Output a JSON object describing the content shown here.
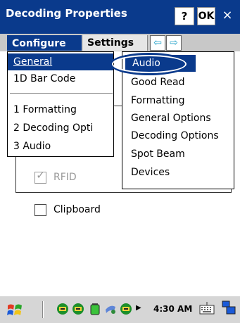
{
  "window": {
    "title": "Decoding Properties",
    "help_label": "?",
    "ok_label": "OK",
    "close_label": "×"
  },
  "tabs": {
    "configure": "Configure",
    "settings": "Settings",
    "left_arrow": "⇦",
    "right_arrow": "⇨"
  },
  "form": {
    "rfid_label": "RFID",
    "clipboard_label": "Clipboard"
  },
  "configure_menu": {
    "general": "General",
    "barcode": "1D Bar Code",
    "formatting": "1 Formatting",
    "decoding": "2 Decoding Opti",
    "audio": "3 Audio"
  },
  "settings_menu": {
    "audio": "Audio",
    "good_read": "Good Read",
    "formatting": "Formatting",
    "general_options": "General Options",
    "decoding_options": "Decoding Options",
    "spot_beam": "Spot Beam",
    "devices": "Devices"
  },
  "taskbar": {
    "clock": "4:30 AM",
    "tray_icons": [
      "network-icon",
      "network-icon",
      "battery-icon",
      "bluetooth-icon",
      "network-icon"
    ]
  },
  "colors": {
    "accent": "#0a3a8c",
    "highlight_text": "#ffffff",
    "disabled_text": "#999999"
  }
}
